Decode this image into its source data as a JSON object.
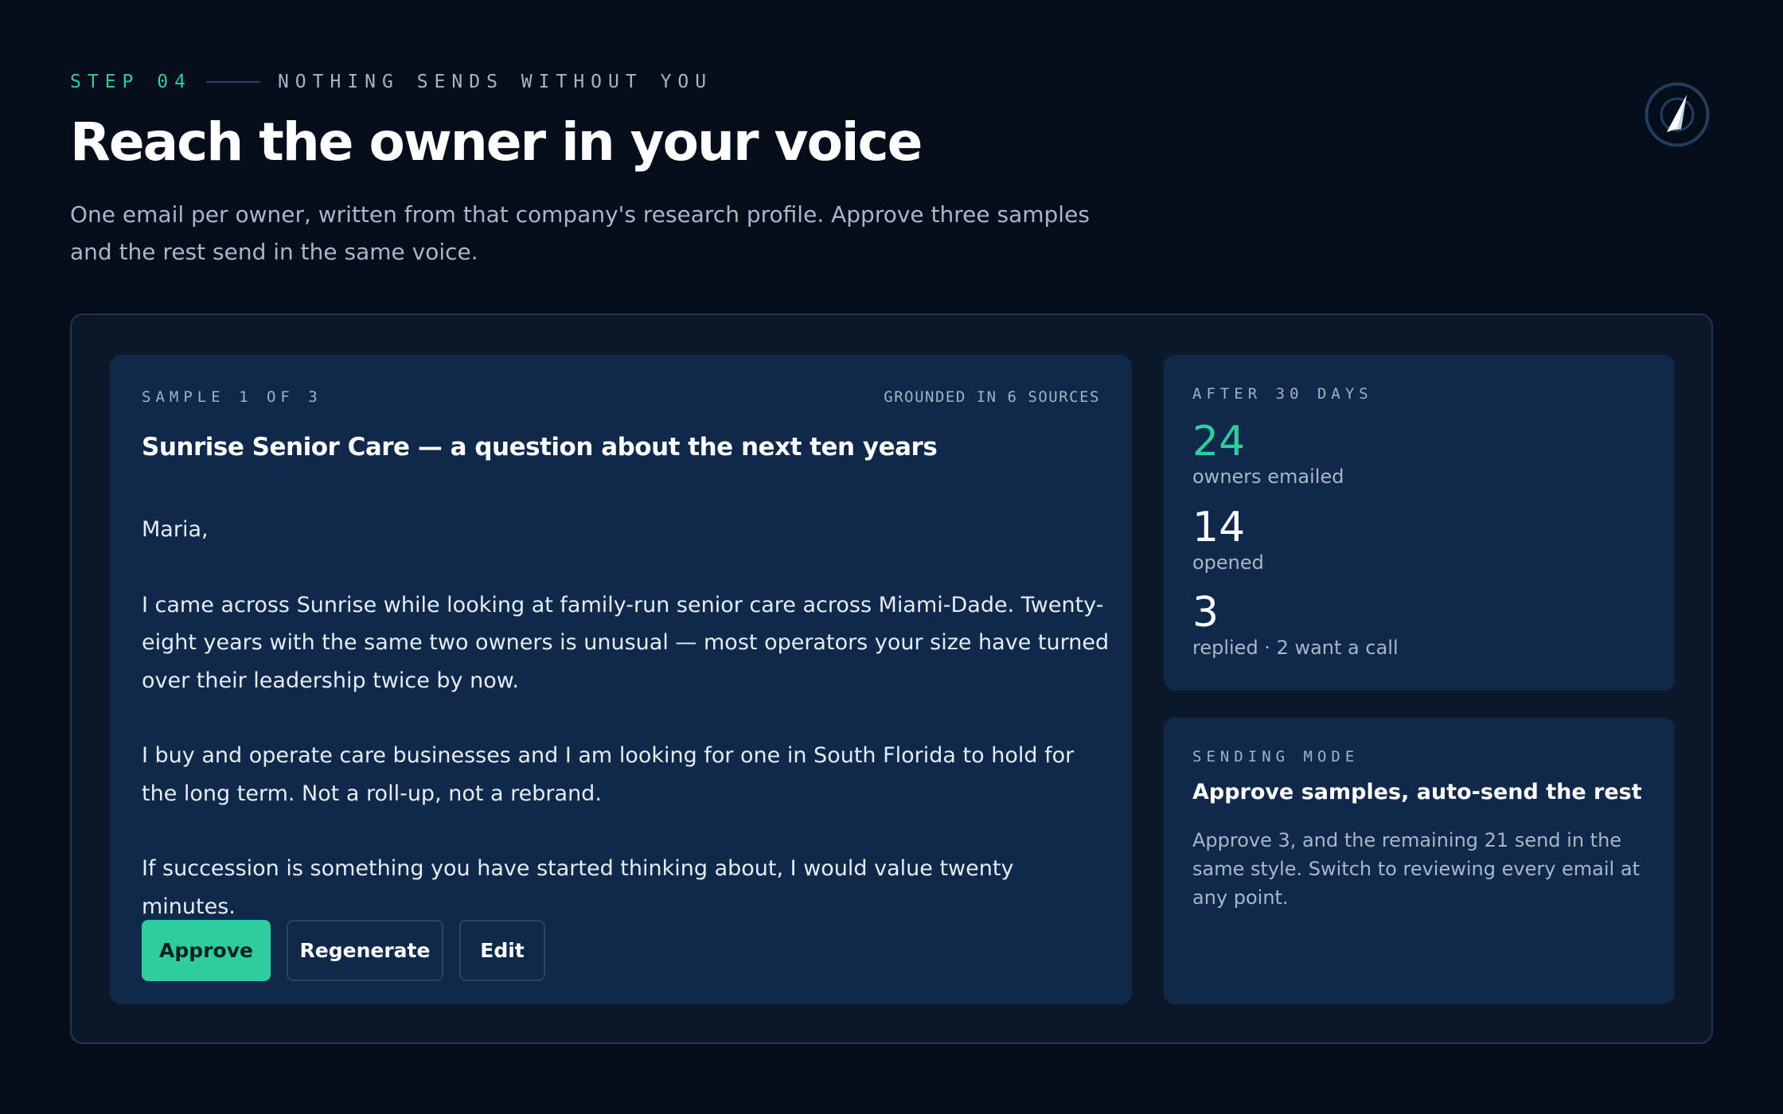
{
  "header": {
    "step": "STEP 04",
    "tagline": "NOTHING SENDS WITHOUT YOU",
    "title": "Reach the owner in your voice",
    "subtitle": "One email per owner, written from that company's research profile. Approve three samples and the rest send in the same voice."
  },
  "email_sample": {
    "sample_label": "SAMPLE 1 OF 3",
    "grounded_label": "GROUNDED IN 6 SOURCES",
    "subject": "Sunrise Senior Care — a question about the next ten years",
    "paragraphs": [
      "Maria,",
      "I came across Sunrise while looking at family-run senior care across Miami-Dade. Twenty-eight years with the same two owners is unusual — most operators your size have turned over their leadership twice by now.",
      "I buy and operate care businesses and I am looking for one in South Florida to hold for the long term. Not a roll-up, not a rebrand.",
      "If succession is something you have started thinking about, I would value twenty minutes."
    ],
    "actions": {
      "approve": "Approve",
      "regenerate": "Regenerate",
      "edit": "Edit"
    }
  },
  "results": {
    "label": "AFTER 30 DAYS",
    "stats": [
      {
        "value": "24",
        "label": "owners emailed"
      },
      {
        "value": "14",
        "label": "opened"
      },
      {
        "value": "3",
        "label": "replied · 2 want a call"
      }
    ]
  },
  "sending_mode": {
    "label": "SENDING MODE",
    "heading": "Approve samples, auto-send the rest",
    "description": "Approve 3, and the remaining 21 send in the same style. Switch to reviewing every email at any point."
  },
  "colors": {
    "accent": "#2ecc9f",
    "background": "#040d19",
    "panel": "#0a1829",
    "card": "#10284a"
  },
  "icons": {
    "top_right": "compass-icon"
  }
}
